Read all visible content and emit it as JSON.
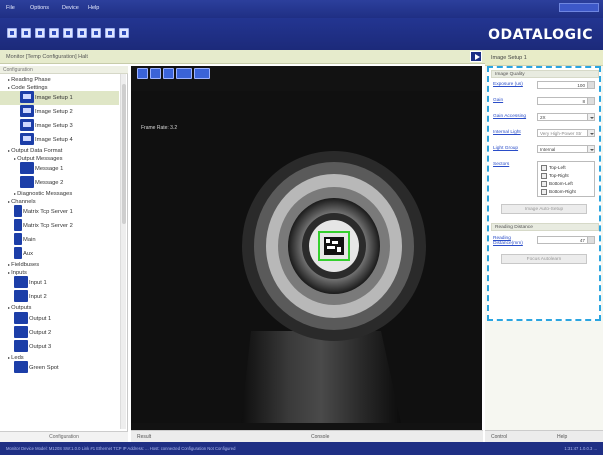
{
  "menu": {
    "items": [
      "File",
      "Options",
      "Device",
      "Help"
    ]
  },
  "toolbar": {
    "logo_text": "ODATALOGIC"
  },
  "monitor_bar": {
    "text": "Monitor   [Temp Configuration]  Halt"
  },
  "config_panel": {
    "title": "Configuration",
    "tree": [
      {
        "label": "Reading Phase",
        "indent": 1
      },
      {
        "label": "Code Settings",
        "indent": 1
      },
      {
        "label": "Image Setup 1",
        "indent": 3,
        "icon": "monitor-icon",
        "selected": true
      },
      {
        "label": "Image Setup 2",
        "indent": 3,
        "icon": "monitor-icon"
      },
      {
        "label": "Image Setup 3",
        "indent": 3,
        "icon": "monitor-icon"
      },
      {
        "label": "Image Setup 4",
        "indent": 3,
        "icon": "monitor-icon"
      },
      {
        "label": "Output Data Format",
        "indent": 1
      },
      {
        "label": "Output Messages",
        "indent": 2
      },
      {
        "label": "Message 1",
        "indent": 3,
        "icon": "message-icon"
      },
      {
        "label": "Message 2",
        "indent": 3,
        "icon": "message-icon"
      },
      {
        "label": "Diagnostic Messages",
        "indent": 2
      },
      {
        "label": "Channels",
        "indent": 1
      },
      {
        "label": "Matrix Tcp Server 1",
        "indent": 2,
        "icon": "server-icon"
      },
      {
        "label": "Matrix Tcp Server 2",
        "indent": 2,
        "icon": "server-icon"
      },
      {
        "label": "Main",
        "indent": 2,
        "icon": "server-icon"
      },
      {
        "label": "Aux",
        "indent": 2,
        "icon": "server-icon"
      },
      {
        "label": "Fieldbuses",
        "indent": 1
      },
      {
        "label": "Inputs",
        "indent": 1
      },
      {
        "label": "Input 1",
        "indent": 2,
        "icon": "input-icon"
      },
      {
        "label": "Input 2",
        "indent": 2,
        "icon": "input-icon"
      },
      {
        "label": "Outputs",
        "indent": 1
      },
      {
        "label": "Output 1",
        "indent": 2,
        "icon": "output-icon"
      },
      {
        "label": "Output 2",
        "indent": 2,
        "icon": "output-icon"
      },
      {
        "label": "Output 3",
        "indent": 2,
        "icon": "output-icon"
      },
      {
        "label": "Leds",
        "indent": 1
      },
      {
        "label": "Green Spot",
        "indent": 2,
        "icon": "led-icon"
      }
    ],
    "bottom_label": "Configuration"
  },
  "viewer": {
    "frame_rate": "Frame Rate: 3.2"
  },
  "bottom_tabs": {
    "result": "Result",
    "console": "Console"
  },
  "right_panel": {
    "header": "Image Setup 1",
    "image_quality": {
      "section": "Image Quality",
      "exposure_label": "Exposure (us)",
      "exposure_value": "100",
      "gain_label": "Gain",
      "gain_value": "8",
      "gain_accessing_label": "Gain Accessing",
      "gain_accessing_value": "2X",
      "internal_light_label": "Internal Light",
      "internal_light_value": "Very High-Power Str",
      "light_group_label": "Light Group",
      "light_group_value": "Internal",
      "sectors_label": "Sectors",
      "sectors": [
        "Top-Left",
        "Top-Right",
        "Bottom-Left",
        "Bottom-Right"
      ],
      "auto_setup_button": "Image Auto-Setup"
    },
    "reading_distance": {
      "section": "Reading Distance",
      "distance_label": "Reading Distance(mm)",
      "distance_value": "47",
      "focus_button": "Focus Autolearn"
    },
    "tabs": {
      "control": "Control",
      "help": "Help"
    }
  },
  "status_bar": {
    "left": "Monitor  Device Model: M120S  SW:1.0.0  Link #1  Ethernet TCP  IP Address: ...  Host: connected  Configuration  Not Configured",
    "right": "1:31:47   1.0.0.3    ..."
  },
  "colors": {
    "brand_blue": "#1f2f84",
    "accent_dash": "#2aa5e0",
    "panel_header": "#e8ecc8"
  }
}
